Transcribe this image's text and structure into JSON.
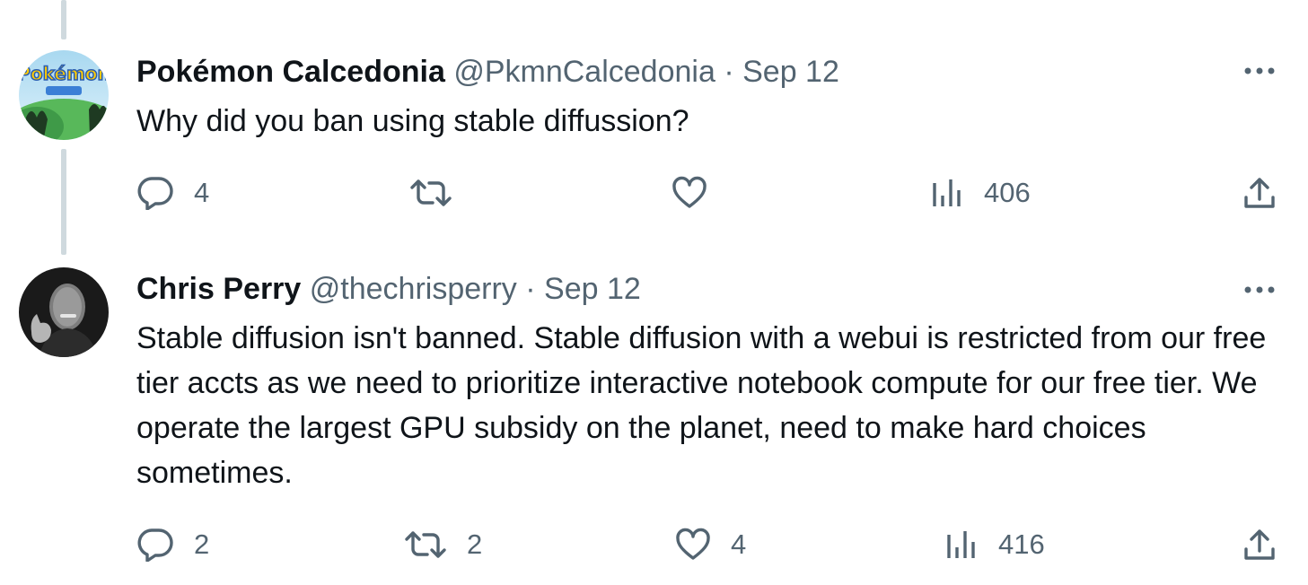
{
  "tweets": [
    {
      "author_name": "Pokémon Calcedonia",
      "handle": "@PkmnCalcedonia",
      "separator": "·",
      "date": "Sep 12",
      "text": "Why did you ban using stable diffussion?",
      "avatar_label": "Pokémon",
      "counts": {
        "replies": "4",
        "reposts": "",
        "likes": "",
        "views": "406"
      }
    },
    {
      "author_name": "Chris Perry",
      "handle": "@thechrisperry",
      "separator": "·",
      "date": "Sep 12",
      "text": "Stable diffusion isn't banned. Stable diffusion with a webui is restricted from our free tier accts as we need to prioritize interactive notebook compute for our free tier. We operate the largest GPU subsidy on the planet, need to make hard choices sometimes.",
      "counts": {
        "replies": "2",
        "reposts": "2",
        "likes": "4",
        "views": "416"
      }
    }
  ],
  "colors": {
    "text": "#0f1419",
    "secondary": "#536471",
    "thread_line": "#cfd9de"
  },
  "icons": [
    "reply-icon",
    "repost-icon",
    "like-icon",
    "views-icon",
    "share-icon",
    "more-icon"
  ]
}
